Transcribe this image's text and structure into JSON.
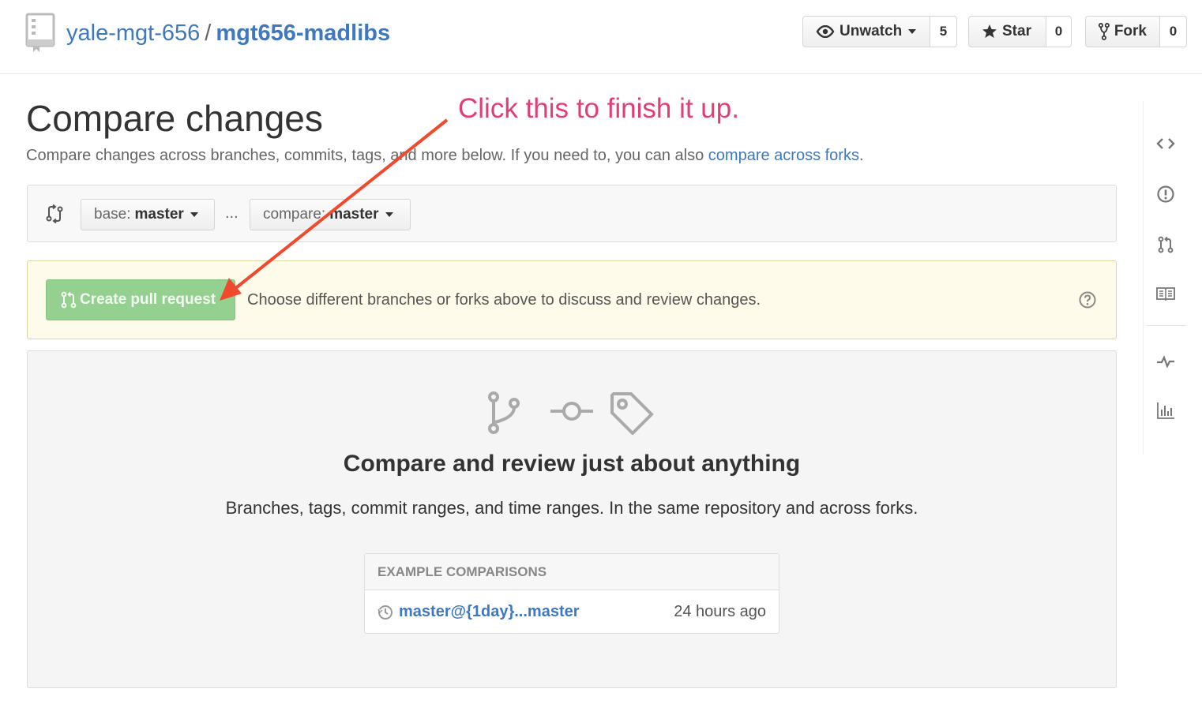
{
  "repo": {
    "owner": "yale-mgt-656",
    "separator": "/",
    "name": "mgt656-madlibs"
  },
  "social": {
    "watch_label": "Unwatch",
    "watch_count": "5",
    "star_label": "Star",
    "star_count": "0",
    "fork_label": "Fork",
    "fork_count": "0"
  },
  "page": {
    "title": "Compare changes",
    "description": "Compare changes across branches, commits, tags, and more below. If you need to, you can also",
    "forks_link": "compare across forks",
    "period": "."
  },
  "range": {
    "base_prefix": "base:",
    "base_branch": "master",
    "dots": "...",
    "compare_prefix": "compare:",
    "compare_branch": "master"
  },
  "flash": {
    "button_label": "Create pull request",
    "message": "Choose different branches or forks above to discuss and review changes."
  },
  "blankslate": {
    "heading": "Compare and review just about anything",
    "text": "Branches, tags, commit ranges, and time ranges. In the same repository and across forks.",
    "examples_header": "EXAMPLE COMPARISONS",
    "examples": [
      {
        "link": "master@{1day}...master",
        "time": "24 hours ago"
      }
    ]
  },
  "annotation": {
    "text": "Click this to finish it up.",
    "color": "#e23d74",
    "arrow_color": "#f04a2e"
  },
  "sidenav": {
    "icons": [
      "code-icon",
      "issues-icon",
      "pull-request-icon",
      "wiki-icon",
      "pulse-icon",
      "graphs-icon"
    ]
  },
  "colors": {
    "link": "#4078c0",
    "flash_bg": "#fffbea",
    "button_green_disabled": "#94d08f"
  }
}
